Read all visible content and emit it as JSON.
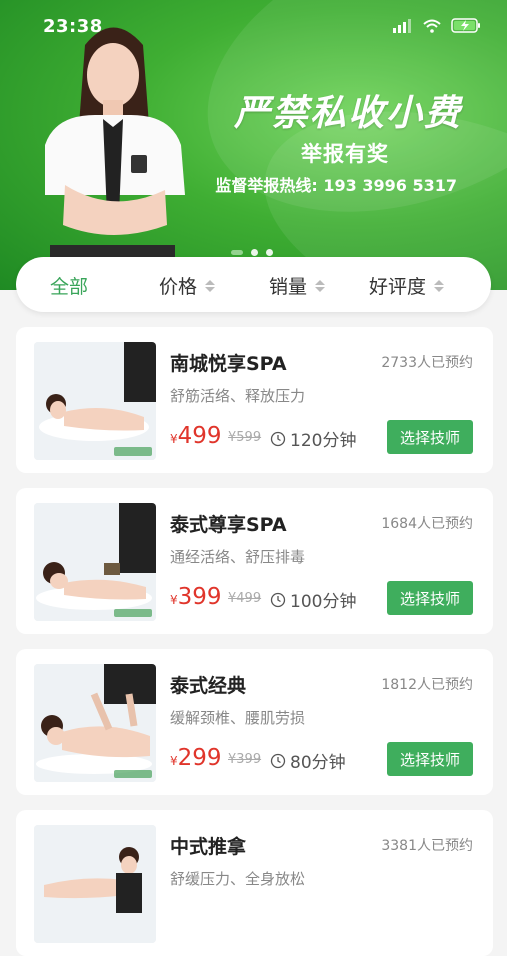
{
  "status": {
    "time": "23:38"
  },
  "banner": {
    "title": "严禁私收小费",
    "subtitle": "举报有奖",
    "hotline": "监督举报热线: 193 3996 5317"
  },
  "filters": [
    {
      "label": "全部",
      "active": true
    },
    {
      "label": "价格"
    },
    {
      "label": "销量"
    },
    {
      "label": "好评度"
    }
  ],
  "services": [
    {
      "name": "南城悦享SPA",
      "booked": "2733人已预约",
      "desc": "舒筋活络、释放压力",
      "currency": "¥",
      "price": "499",
      "original": "¥599",
      "duration": "120分钟",
      "button": "选择技师"
    },
    {
      "name": "泰式尊享SPA",
      "booked": "1684人已预约",
      "desc": "通经活络、舒压排毒",
      "currency": "¥",
      "price": "399",
      "original": "¥499",
      "duration": "100分钟",
      "button": "选择技师"
    },
    {
      "name": "泰式经典",
      "booked": "1812人已预约",
      "desc": "缓解颈椎、腰肌劳损",
      "currency": "¥",
      "price": "299",
      "original": "¥399",
      "duration": "80分钟",
      "button": "选择技师"
    },
    {
      "name": "中式推拿",
      "booked": "3381人已预约",
      "desc": "舒缓压力、全身放松"
    }
  ]
}
